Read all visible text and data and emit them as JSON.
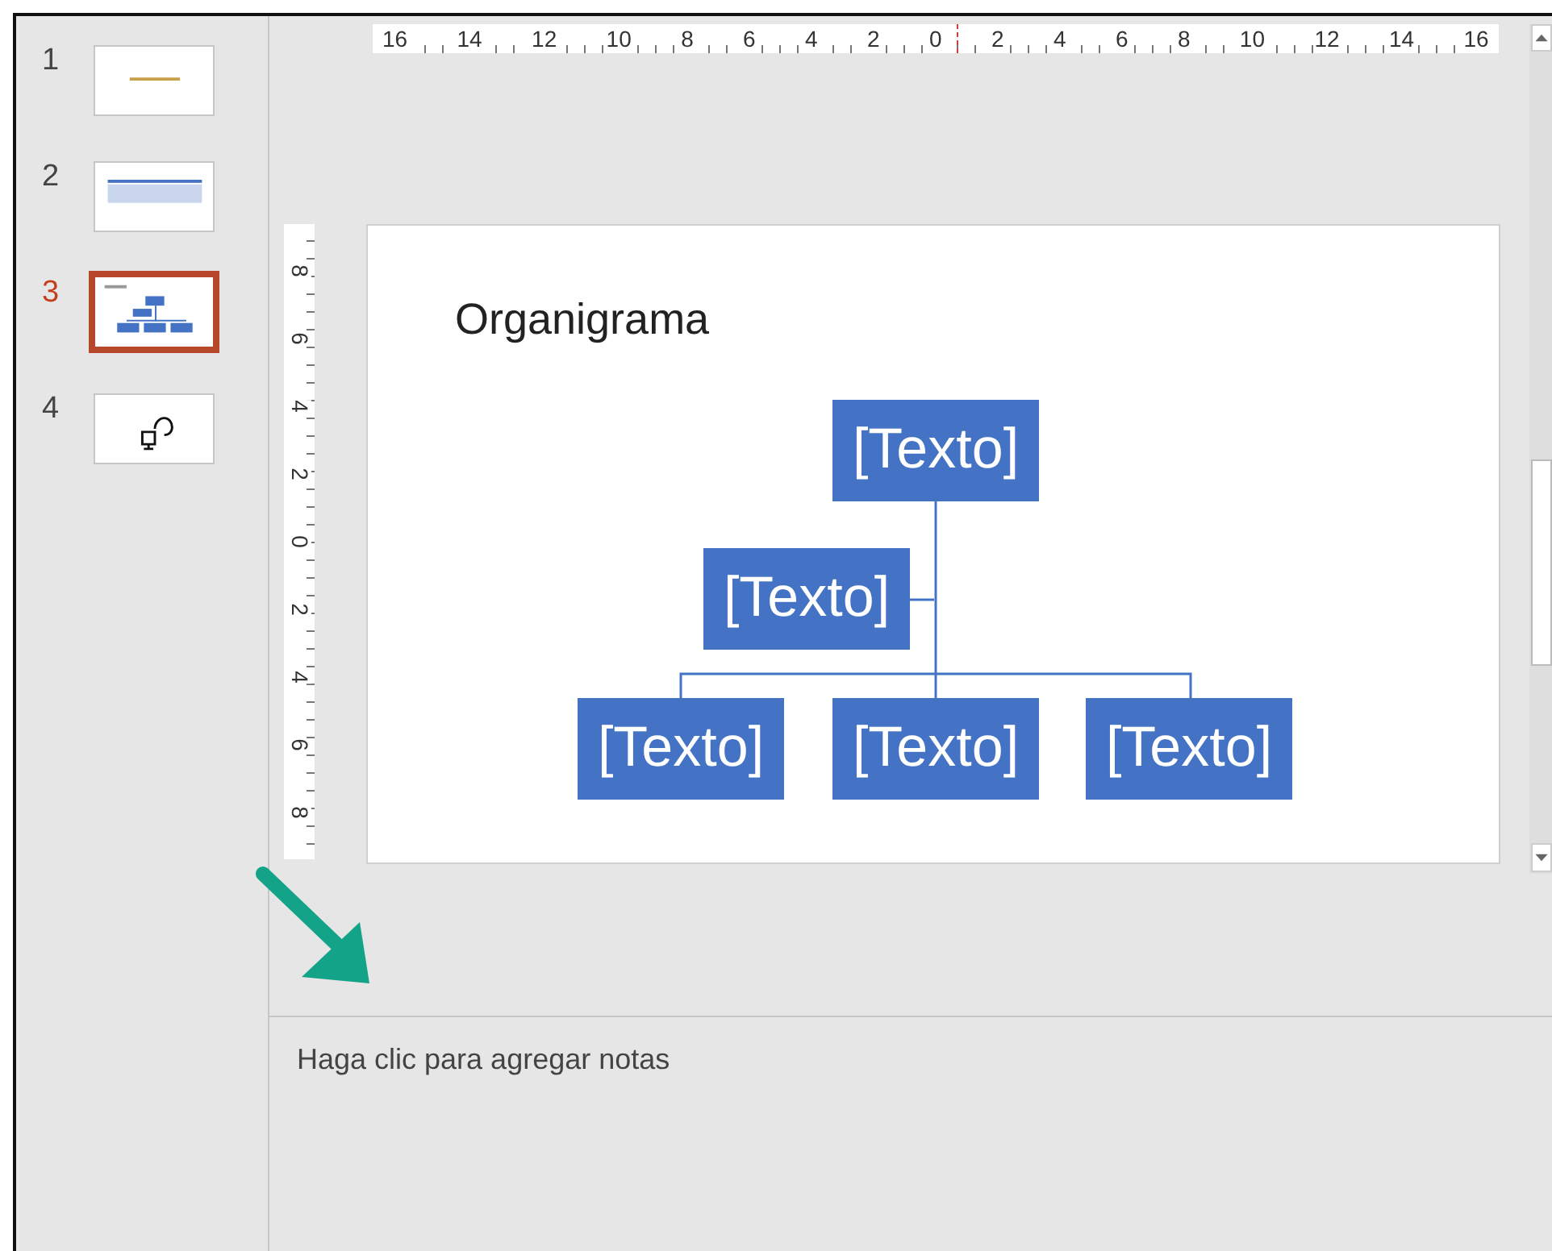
{
  "slides": [
    {
      "number": "1",
      "kind": "title",
      "selected": false
    },
    {
      "number": "2",
      "kind": "table",
      "selected": false
    },
    {
      "number": "3",
      "kind": "org-chart",
      "selected": true
    },
    {
      "number": "4",
      "kind": "icon",
      "selected": false
    }
  ],
  "horizontal_ruler": [
    "16",
    "14",
    "12",
    "10",
    "8",
    "6",
    "4",
    "2",
    "0",
    "2",
    "4",
    "6",
    "8",
    "10",
    "12",
    "14",
    "16"
  ],
  "vertical_ruler": [
    "8",
    "6",
    "4",
    "2",
    "0",
    "2",
    "4",
    "6",
    "8"
  ],
  "slide": {
    "title": "Organigrama",
    "org_chart": {
      "top": {
        "label": "[Texto]"
      },
      "assistant": {
        "label": "[Texto]"
      },
      "subordinates": [
        {
          "label": "[Texto]"
        },
        {
          "label": "[Texto]"
        },
        {
          "label": "[Texto]"
        }
      ]
    }
  },
  "notes": {
    "placeholder": "Haga clic para agregar notas"
  }
}
